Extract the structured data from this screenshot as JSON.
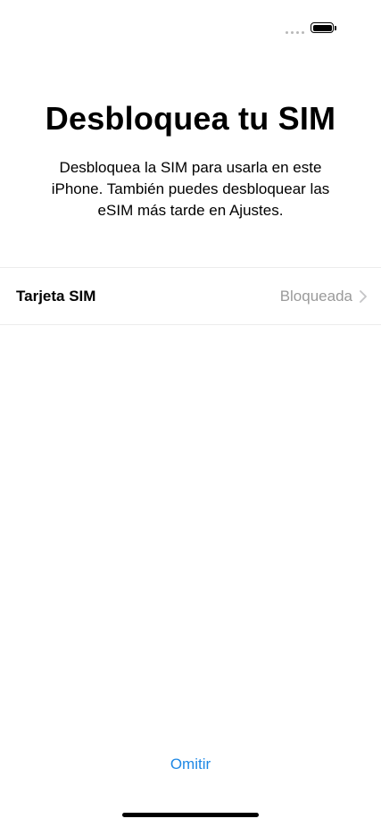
{
  "status_bar": {
    "signal_icon": "signal-dots-icon",
    "battery_icon": "battery-full-icon",
    "battery_level": 1.0
  },
  "title": "Desbloquea tu SIM",
  "subtitle": "Desbloquea la SIM para usarla en este iPhone. También puedes desbloquear las eSIM más tarde en Ajustes.",
  "sim_row": {
    "label": "Tarjeta SIM",
    "status": "Bloqueada",
    "chevron_icon": "chevron-right-icon"
  },
  "skip_label": "Omitir",
  "colors": {
    "accent": "#1e88e5",
    "secondary_text": "#9a9a9a",
    "divider": "#ececec"
  }
}
